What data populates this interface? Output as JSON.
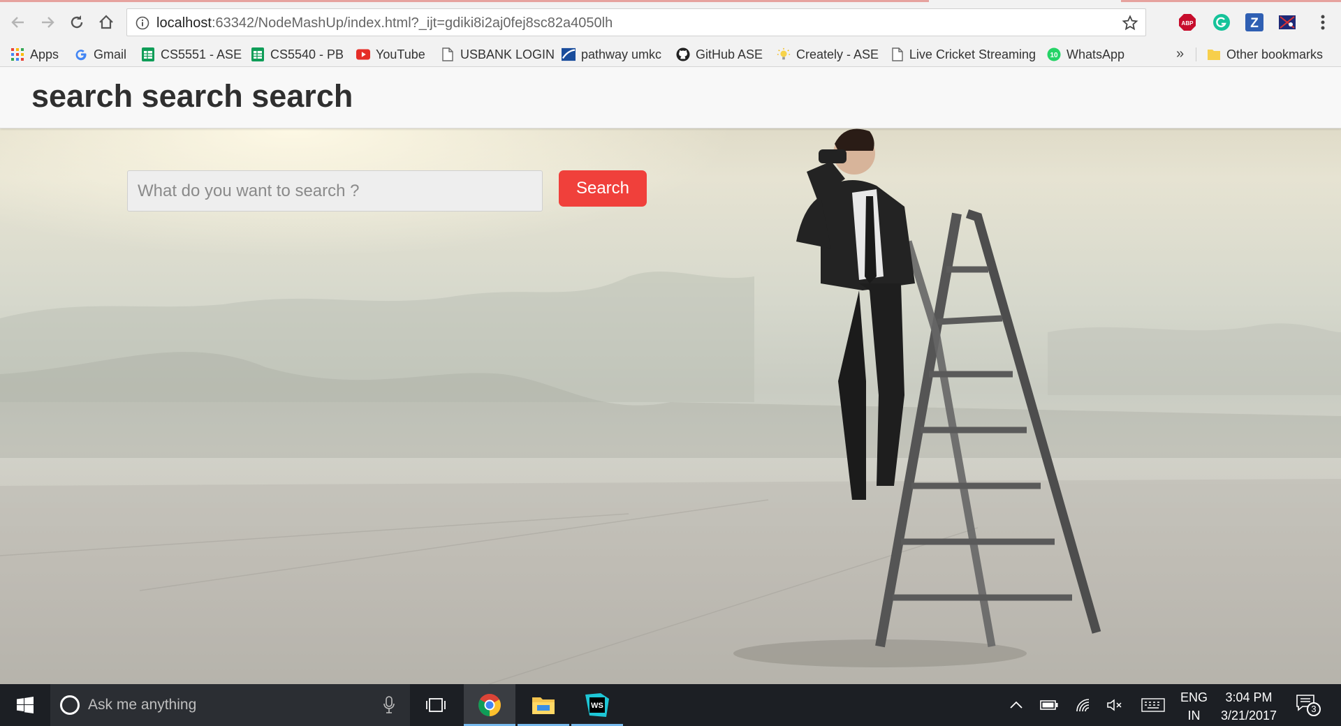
{
  "browser": {
    "url_host": "localhost",
    "url_rest": ":63342/NodeMashUp/index.html?_ijt=gdiki8i2aj0fej8sc82a4050lh",
    "extensions": [
      "ABP",
      "Grammarly",
      "Z",
      "Extension"
    ]
  },
  "bookmarks": [
    {
      "label": "Apps",
      "icon": "apps-grid-icon"
    },
    {
      "label": "Gmail",
      "icon": "google-icon"
    },
    {
      "label": "CS5551 - ASE",
      "icon": "sheets-icon"
    },
    {
      "label": "CS5540 - PB",
      "icon": "sheets-icon"
    },
    {
      "label": "YouTube",
      "icon": "youtube-icon"
    },
    {
      "label": "USBANK LOGIN",
      "icon": "page-icon"
    },
    {
      "label": "pathway umkc",
      "icon": "pathway-icon"
    },
    {
      "label": "GitHub ASE",
      "icon": "github-icon"
    },
    {
      "label": "Creately - ASE",
      "icon": "bulb-icon"
    },
    {
      "label": "Live Cricket Streaming",
      "icon": "page-icon"
    },
    {
      "label": "WhatsApp",
      "icon": "whatsapp-icon"
    }
  ],
  "bookmarks_more": "»",
  "other_bookmarks": "Other bookmarks",
  "page": {
    "brand": "search search search",
    "search_placeholder": "What do you want to search ?",
    "search_button": "Search"
  },
  "taskbar": {
    "cortana_placeholder": "Ask me anything",
    "lang_line1": "ENG",
    "lang_line2": "IN",
    "time": "3:04 PM",
    "date": "3/21/2017",
    "notification_count": "3"
  },
  "colors": {
    "accent_button": "#f0403b",
    "navbar_bg": "#f8f8f8",
    "taskbar_bg": "#1c1f24"
  }
}
